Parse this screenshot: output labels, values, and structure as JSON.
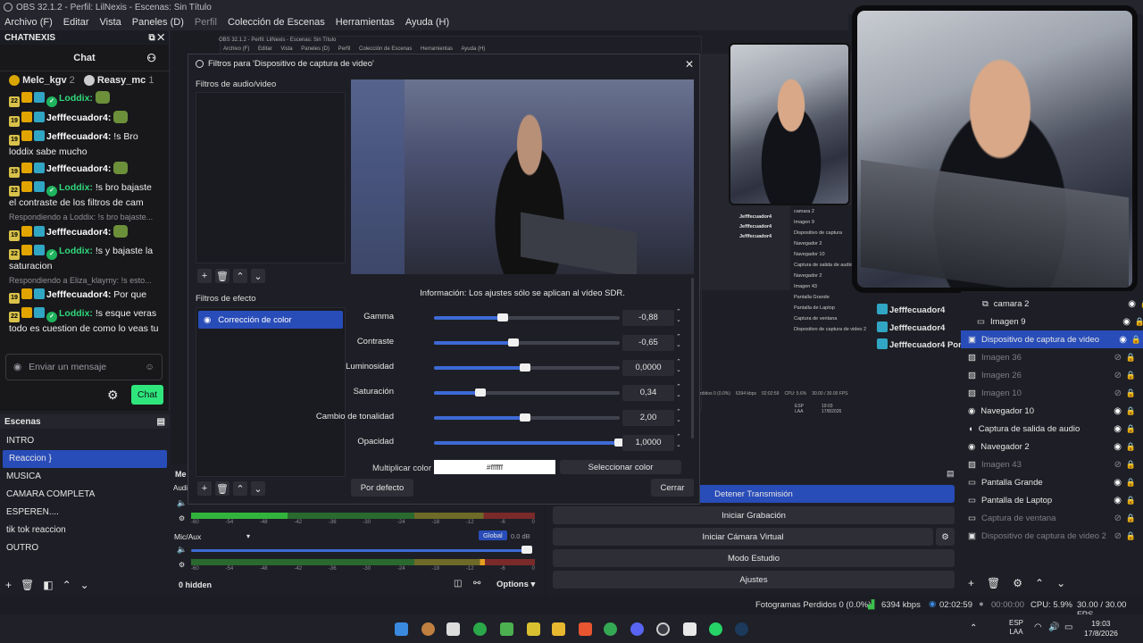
{
  "window": {
    "title": "OBS 32.1.2 - Perfil: LilNexis - Escenas: Sin Título"
  },
  "menu": [
    "Archivo (F)",
    "Editar",
    "Vista",
    "Paneles (D)",
    "Perfil",
    "Colección de Escenas",
    "Herramientas",
    "Ayuda (H)"
  ],
  "chat": {
    "dock_title": "CHATNEXIS",
    "header": "Chat",
    "top_users": [
      {
        "name": "Melc_kgv",
        "count": "2"
      },
      {
        "name": "Reasy_mc",
        "count": "1"
      }
    ],
    "messages": [
      {
        "badge_num": "22",
        "user": "Loddix:",
        "text": "",
        "mod": true
      },
      {
        "badge_num": "19",
        "user": "Jefffecuador4:",
        "text": "",
        "mod": false
      },
      {
        "badge_num": "19",
        "user": "Jefffecuador4:",
        "text": "!s Bro loddix sabe mucho",
        "mod": false
      },
      {
        "badge_num": "19",
        "user": "Jefffecuador4:",
        "text": "",
        "mod": false
      },
      {
        "badge_num": "22",
        "user": "Loddix:",
        "text": "!s bro bajaste el contraste de los filtros de cam",
        "mod": true
      },
      {
        "reply": "Respondiendo a Loddix: !s bro bajaste...",
        "badge_num": "19",
        "user": "Jefffecuador4:",
        "text": "",
        "mod": false
      },
      {
        "badge_num": "22",
        "user": "Loddix:",
        "text": "!s y bajaste la saturacion",
        "mod": true
      },
      {
        "reply": "Respondiendo a Eliza_klaymy: !s esto...",
        "badge_num": "19",
        "user": "Jefffecuador4:",
        "text": "Por que",
        "mod": false
      },
      {
        "badge_num": "22",
        "user": "Loddix:",
        "text": "!s esque veras todo es cuestion de como lo veas tu",
        "mod": true
      }
    ],
    "input_placeholder": "Enviar un mensaje",
    "send_label": "Chat"
  },
  "scenes": {
    "title": "Escenas",
    "items": [
      "INTRO",
      "Reaccion }",
      "MUSICA",
      "CAMARA COMPLETA",
      "ESPEREN....",
      "tik tok reaccion",
      "OUTRO"
    ],
    "active_index": 1
  },
  "mini_menu": [
    "OBS 32.1.2 - Perfil: LilNexis - Escenas: Sin Título",
    "Archivo (F)",
    "Editar",
    "Vista",
    "Paneles (D)",
    "Perfil",
    "Colección de Escenas",
    "Herramientas",
    "Ayuda (H)"
  ],
  "dialog": {
    "title": "Filtros para 'Dispositivo de captura de video'",
    "audio_video_label": "Filtros de audio/video",
    "effect_label": "Filtros de efecto",
    "effect_filter": "Corrección de color",
    "info": "Información: Los ajustes sólo se aplican al vídeo SDR.",
    "properties": [
      {
        "label": "Gamma",
        "value": "-0,88",
        "fraction": 0.37
      },
      {
        "label": "Contraste",
        "value": "-0,65",
        "fraction": 0.43
      },
      {
        "label": "Luminosidad",
        "value": "0,0000",
        "fraction": 0.49
      },
      {
        "label": "Saturación",
        "value": "0,34",
        "fraction": 0.25
      },
      {
        "label": "Cambio de tonalidad",
        "value": "2,00",
        "fraction": 0.49
      },
      {
        "label": "Opacidad",
        "value": "1,0000",
        "fraction": 1.0
      }
    ],
    "color_label": "Multiplicar color",
    "color_value": "#ffffff",
    "select_color": "Seleccionar color",
    "defaults_btn": "Por defecto",
    "close_btn": "Cerrar"
  },
  "sources": {
    "items": [
      {
        "name": "camara 2",
        "dim": false,
        "visible": true
      },
      {
        "name": "Imagen 9",
        "dim": false,
        "visible": true
      },
      {
        "name": "Dispositivo de captura de video",
        "dim": false,
        "visible": true,
        "active": true
      },
      {
        "name": "Imagen 36",
        "dim": true,
        "visible": false
      },
      {
        "name": "Imagen 26",
        "dim": true,
        "visible": false
      },
      {
        "name": "Imagen 10",
        "dim": true,
        "visible": false
      },
      {
        "name": "Navegador 10",
        "dim": false,
        "visible": true
      },
      {
        "name": "Captura de salida de audio",
        "dim": false,
        "visible": true
      },
      {
        "name": "Navegador 2",
        "dim": false,
        "visible": true
      },
      {
        "name": "Imagen 43",
        "dim": true,
        "visible": false
      },
      {
        "name": "Pantalla Grande",
        "dim": false,
        "visible": true
      },
      {
        "name": "Pantalla de Laptop",
        "dim": false,
        "visible": true
      },
      {
        "name": "Captura de ventana",
        "dim": true,
        "visible": false
      },
      {
        "name": "Dispositivo de captura de video 2",
        "dim": true,
        "visible": false
      }
    ]
  },
  "overlay_chat": [
    {
      "user": "Jefffecuador4",
      "text": ""
    },
    {
      "user": "Jefffecuador4",
      "text": ""
    },
    {
      "user": "Jefffecuador4",
      "text": "Por que"
    }
  ],
  "mini_sources": [
    "camara 2",
    "Imagen 9",
    "Dispositivo de captura",
    "Navegador 2",
    "Navegador 10",
    "Captura de salida de audio",
    "Navegador 2",
    "Imagen 43",
    "Pantalla Grande",
    "Pantalla de Laptop",
    "Captura de ventana",
    "Dispositivo de captura de video 2"
  ],
  "mini_chat_user": "Jefffecuador4",
  "mini_status": {
    "frames": "rdidos 0 (0.0%)",
    "kbps": "6394 kbps",
    "time": "02:02:59",
    "cpu": "CPU: 5.6%",
    "fps": "30.00 / 30.00 FPS",
    "lang": "ESP",
    "region": "LAA",
    "clock": "19:03",
    "date": "17/8/2026"
  },
  "controls": {
    "stop_stream": "Detener Transmisión",
    "start_record": "Iniciar Grabación",
    "virtual_cam": "Iniciar Cámara Virtual",
    "studio": "Modo Estudio",
    "settings": "Ajustes"
  },
  "mixer": {
    "partial_label": "Me",
    "partial_label2": "Audi",
    "mic_label": "Mic/Aux",
    "global": "Global",
    "db": "0.0 dB",
    "ticks": [
      "-60",
      "-54",
      "-48",
      "-42",
      "-36",
      "-30",
      "-24",
      "-18",
      "-12",
      "-6",
      "0"
    ],
    "hidden": "0 hidden",
    "options": "Options"
  },
  "status": {
    "frames": "Fotogramas Perdidos 0 (0.0%)",
    "kbps": "6394 kbps",
    "stream_time": "02:02:59",
    "rec_time": "00:00:00",
    "cpu": "CPU: 5.9%",
    "fps": "30.00 / 30.00 FPS"
  },
  "taskbar": {
    "lang": "ESP",
    "region": "LAA",
    "time": "19:03",
    "date": "17/8/2026"
  },
  "colors": {
    "accent": "#284cb8",
    "chat_green": "#2fe67d",
    "background": "#1e1f26"
  }
}
